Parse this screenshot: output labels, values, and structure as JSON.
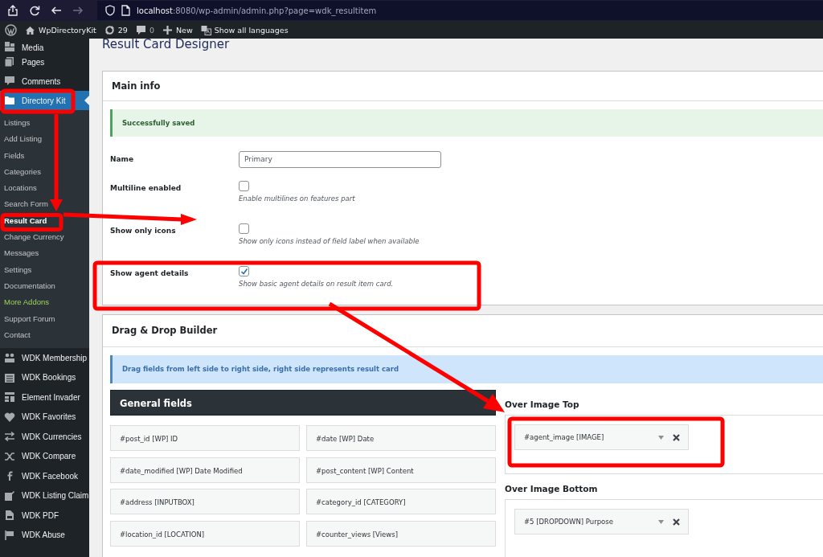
{
  "browser": {
    "url_host": "localhost",
    "url_path": ":8080/wp-admin/admin.php?page=wdk_resultitem"
  },
  "admin_bar": {
    "site": "WpDirectoryKit",
    "updates": "29",
    "comments": "0",
    "new": "New",
    "languages": "Show all languages"
  },
  "sidebar": {
    "top_items": [
      {
        "label": "Media"
      },
      {
        "label": "Pages"
      },
      {
        "label": "Comments"
      }
    ],
    "current": {
      "label": "Directory Kit",
      "selected": true
    },
    "submenu": [
      {
        "label": "Listings",
        "selected": false,
        "highlighted": false
      },
      {
        "label": "Add Listing",
        "selected": false,
        "highlighted": false
      },
      {
        "label": "Fields",
        "selected": false,
        "highlighted": false
      },
      {
        "label": "Categories",
        "selected": false,
        "highlighted": false
      },
      {
        "label": "Locations",
        "selected": false,
        "highlighted": false
      },
      {
        "label": "Search Form",
        "selected": false,
        "highlighted": false
      },
      {
        "label": "Result Card",
        "selected": true,
        "highlighted": false
      },
      {
        "label": "Change Currency",
        "selected": false,
        "highlighted": false
      },
      {
        "label": "Messages",
        "selected": false,
        "highlighted": false
      },
      {
        "label": "Settings",
        "selected": false,
        "highlighted": false
      },
      {
        "label": "Documentation",
        "selected": false,
        "highlighted": false
      },
      {
        "label": "More Addons",
        "selected": false,
        "highlighted": true
      },
      {
        "label": "Support Forum",
        "selected": false,
        "highlighted": false
      },
      {
        "label": "Contact",
        "selected": false,
        "highlighted": false
      }
    ],
    "addon_items": [
      {
        "label": "WDK Membership"
      },
      {
        "label": "WDK Bookings"
      },
      {
        "label": "Element Invader"
      },
      {
        "label": "WDK Favorites"
      },
      {
        "label": "WDK Currencies"
      },
      {
        "label": "WDK Compare"
      },
      {
        "label": "WDK Facebook"
      },
      {
        "label": "WDK Listing Claim"
      },
      {
        "label": "WDK PDF"
      },
      {
        "label": "WDK Abuse"
      }
    ]
  },
  "page_title": "Result Card Designer",
  "main_info": {
    "title": "Main info",
    "notice": "Successfully saved",
    "name_field": {
      "label": "Name",
      "value": "Primary"
    },
    "options": [
      {
        "label": "Multiline enabled",
        "checked": false,
        "description": "Enable multilines on features part"
      },
      {
        "label": "Show only icons",
        "checked": false,
        "description": "Show only icons instead of field label when available"
      },
      {
        "label": "Show agent details",
        "checked": true,
        "description": "Show basic agent details on result item card."
      }
    ]
  },
  "builder": {
    "title": "Drag & Drop Builder",
    "notice": "Drag fields from left side to right side, right side represents result card",
    "general_fields": {
      "title": "General fields",
      "fields": [
        "#post_id [WP] ID",
        "#date [WP] Date",
        "#date_modified [WP] Date Modified",
        "#post_content [WP] Content",
        "#address [INPUTBOX]",
        "#category_id [CATEGORY]",
        "#location_id [LOCATION]",
        "#counter_views [Views]"
      ]
    },
    "zones": [
      {
        "title": "Over Image Top",
        "items": [
          "#agent_image [IMAGE]"
        ]
      },
      {
        "title": "Over Image Bottom",
        "items": [
          "#5 [DROPDOWN] Purpose"
        ]
      }
    ]
  }
}
